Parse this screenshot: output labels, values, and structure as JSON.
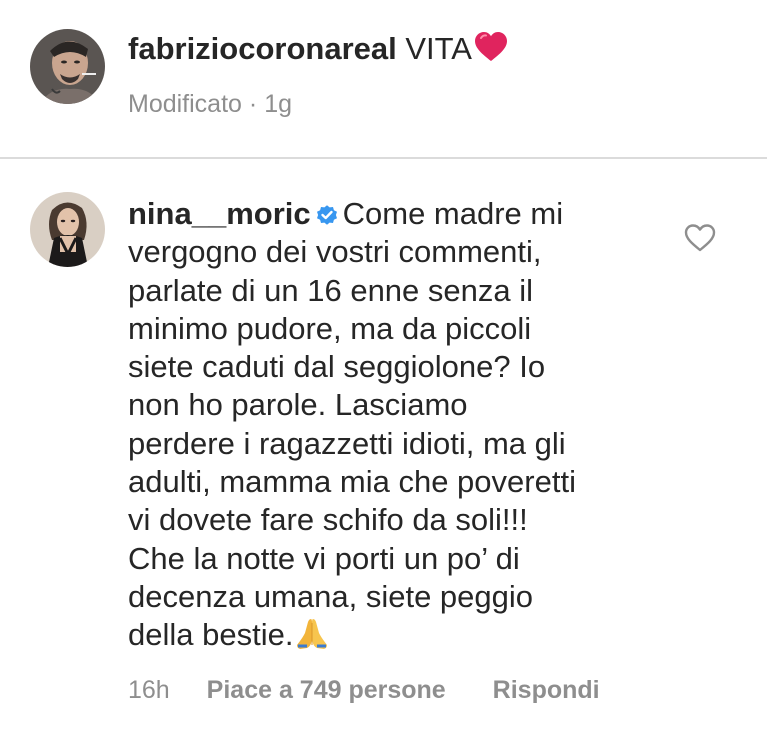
{
  "post": {
    "author": {
      "username": "fabriziocoronareal",
      "avatar": "avatar-fabriziocoronareal"
    },
    "caption": "VITA",
    "caption_emoji": "red-heart-emoji",
    "edited_label": "Modificato",
    "separator": "·",
    "timestamp": "1g"
  },
  "comment": {
    "author": {
      "username": "nina__moric",
      "verified": true,
      "avatar": "avatar-nina__moric"
    },
    "lines": [
      "Come madre mi",
      "vergogno dei vostri commenti,",
      "parlate di un 16 enne senza il",
      "minimo pudore, ma da piccoli",
      "siete caduti dal seggiolone? Io",
      "non ho parole. Lasciamo",
      "perdere i ragazzetti idioti, ma gli",
      "adulti, mamma mia che poveretti",
      "vi dovete fare schifo da soli!!!",
      "Che la notte vi porti un po’ di",
      "decenza umana, siete peggio",
      "della bestie."
    ],
    "end_emoji": "folded-hands-emoji",
    "time": "16h",
    "likes_label": "Piace a 749 persone",
    "reply_label": "Rispondi"
  },
  "colors": {
    "text_primary": "#262626",
    "text_secondary": "#8e8e8e",
    "divider": "#dbdbdb",
    "verified_badge": "#3897f0",
    "heart_red": "#e0245e"
  },
  "icons": {
    "like": "heart-outline-icon",
    "verified": "verified-badge-icon"
  }
}
